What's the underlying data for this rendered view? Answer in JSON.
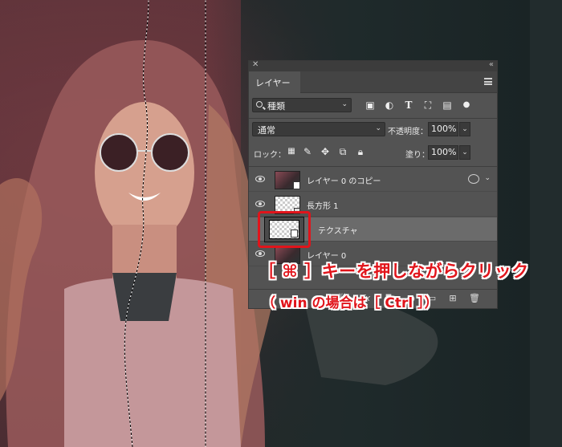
{
  "panel": {
    "tab_label": "レイヤー",
    "filter": {
      "kind_label": "種類"
    },
    "blend": {
      "mode": "通常",
      "opacity_label": "不透明度：",
      "opacity_value": "100%"
    },
    "lock": {
      "label": "ロック：",
      "fill_label": "塗り：",
      "fill_value": "100%"
    },
    "layers": [
      {
        "name": "レイヤー 0 のコピー",
        "visible": true,
        "selected": false,
        "has_fx": true
      },
      {
        "name": "長方形 1",
        "visible": true,
        "selected": false,
        "has_fx": false
      },
      {
        "name": "テクスチャ",
        "visible": false,
        "selected": true,
        "has_fx": false
      },
      {
        "name": "レイヤー 0",
        "visible": true,
        "selected": false,
        "has_fx": false
      }
    ]
  },
  "annotation": {
    "line1": "［ ⌘ ］キーを押しながらクリック",
    "line2": "（ win の場合は［ Ctrl ］）"
  },
  "colors": {
    "accent_red": "#e1141b",
    "panel_bg": "#535353",
    "selected_row": "#6b6b6b"
  }
}
